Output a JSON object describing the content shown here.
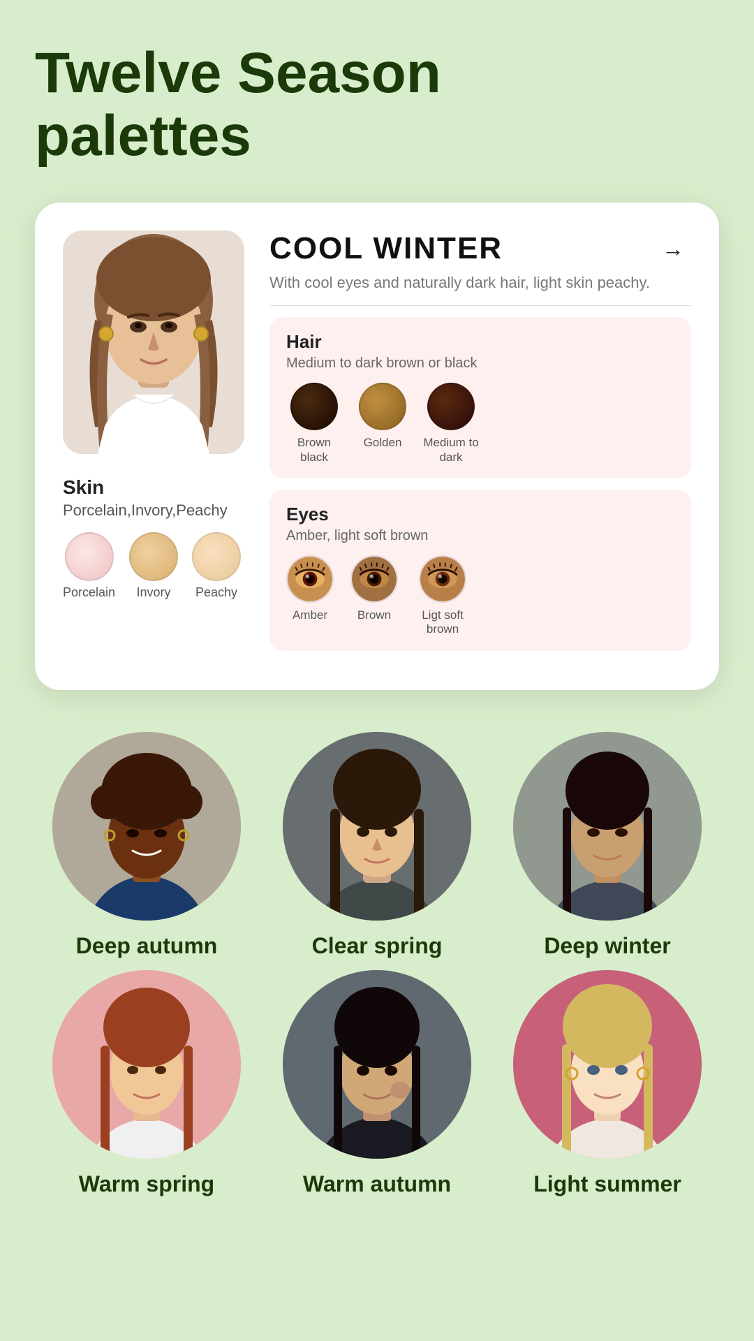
{
  "page": {
    "title_line1": "Twelve Season",
    "title_line2": "palettes"
  },
  "card": {
    "season_name": "COOL WINTER",
    "season_desc": "With cool eyes and naturally dark hair, light skin peachy.",
    "arrow": "→",
    "skin": {
      "label": "Skin",
      "subtitle": "Porcelain,Invory,Peachy",
      "swatches": [
        {
          "color": "#f2c2c2",
          "name": "Porcelain"
        },
        {
          "color": "#e8c090",
          "name": "Invory"
        },
        {
          "color": "#f0d4b0",
          "name": "Peachy"
        }
      ]
    },
    "hair": {
      "label": "Hair",
      "subtitle": "Medium to dark brown or black",
      "swatches": [
        {
          "color": "#2a1a0a",
          "name": "Brown black"
        },
        {
          "color": "#a07838",
          "name": "Golden"
        },
        {
          "color": "#3a1a08",
          "name": "Medium to dark"
        }
      ]
    },
    "eyes": {
      "label": "Eyes",
      "subtitle": "Amber, light soft brown",
      "swatches": [
        {
          "emoji": "👁️",
          "color": "#8b4513",
          "name": "Amber"
        },
        {
          "emoji": "👁️",
          "color": "#6b3010",
          "name": "Brown"
        },
        {
          "emoji": "👁️",
          "color": "#a06040",
          "name": "Ligt soft brown"
        }
      ]
    }
  },
  "portraits_row1": [
    {
      "name": "Deep autumn",
      "bg": "#b0a898"
    },
    {
      "name": "Clear spring",
      "bg": "#6a7068"
    },
    {
      "name": "Deep winter",
      "bg": "#909890"
    }
  ],
  "portraits_row2": [
    {
      "name": "Warm spring",
      "bg": "#e8a8a8"
    },
    {
      "name": "Warm autumn",
      "bg": "#606870"
    },
    {
      "name": "Light summer",
      "bg": "#c8607a"
    }
  ]
}
